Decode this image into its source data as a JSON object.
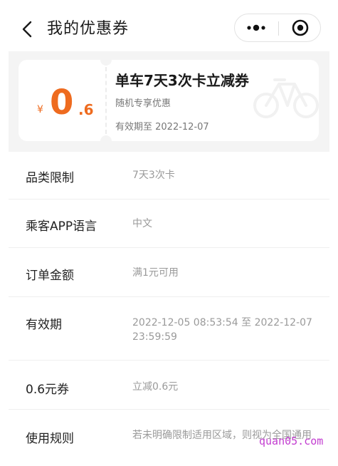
{
  "header": {
    "title": "我的优惠券"
  },
  "coupon": {
    "currency": "¥",
    "amount_int": "0",
    "amount_dec": ".6",
    "title": "单车7天3次卡立减券",
    "subtitle": "随机专享优惠",
    "valid_until": "有效期至 2022-12-07"
  },
  "details": [
    {
      "label": "品类限制",
      "value": "7天3次卡"
    },
    {
      "label": "乘客APP语言",
      "value": "中文"
    },
    {
      "label": "订单金额",
      "value": "满1元可用"
    },
    {
      "label": "有效期",
      "value": "2022-12-05 08:53:54 至 2022-12-07 23:59:59"
    },
    {
      "label": "0.6元券",
      "value": "立减0.6元"
    },
    {
      "label": "使用规则",
      "value": "若未明确限制适用区域，则视为全国通用"
    }
  ],
  "watermark": "quan05.com",
  "colors": {
    "accent": "#ee6b1f",
    "label_text": "#222222",
    "value_text": "#9a9a9a",
    "watermark": "#c23cd0"
  }
}
